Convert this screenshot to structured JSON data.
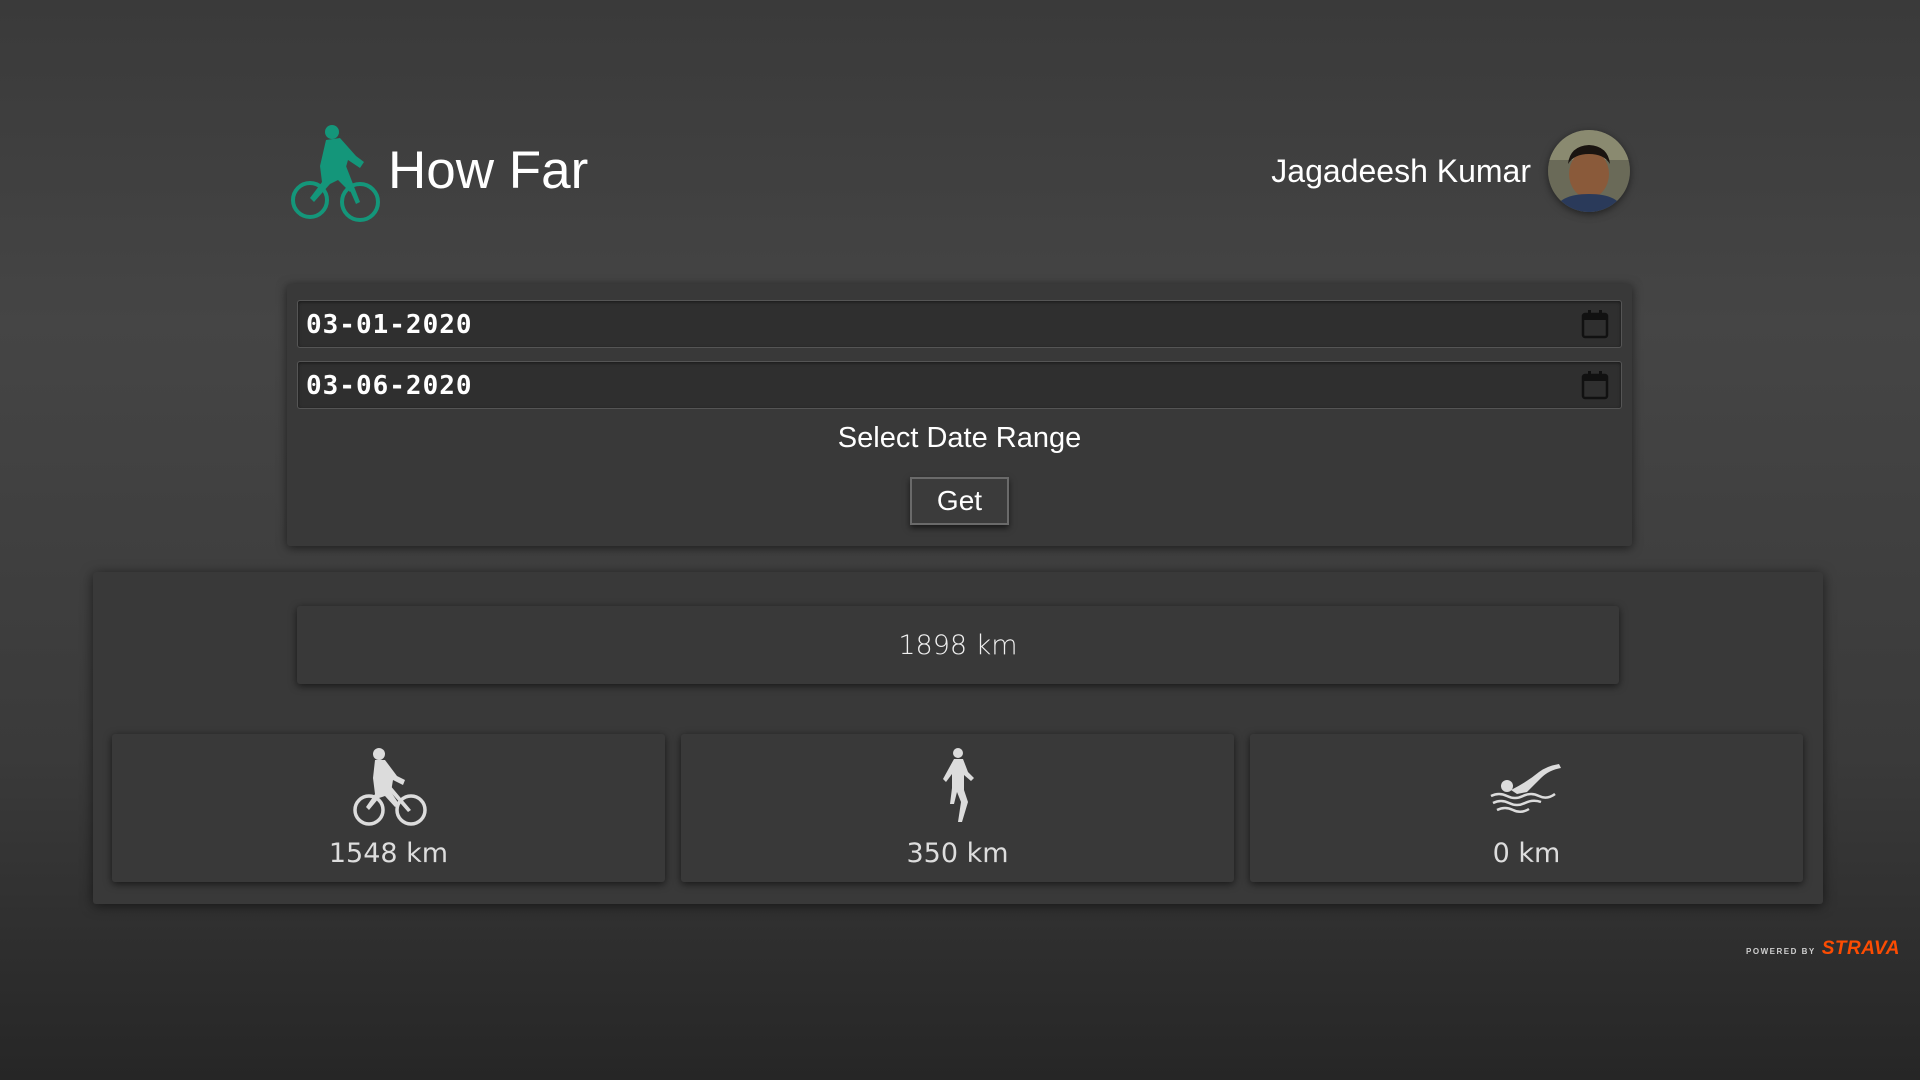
{
  "header": {
    "app_title": "How Far",
    "user_name": "Jagadeesh Kumar",
    "logo_icon": "cyclist-icon",
    "logo_color": "#14967a"
  },
  "date_range": {
    "start_date": "03-01-2020",
    "end_date": "03-06-2020",
    "label": "Select Date Range",
    "button_label": "Get"
  },
  "results": {
    "total": "1898 km",
    "sports": [
      {
        "icon": "cycling-icon",
        "value": "1548 km"
      },
      {
        "icon": "running-icon",
        "value": "350 km"
      },
      {
        "icon": "swimming-icon",
        "value": "0 km"
      }
    ]
  },
  "footer": {
    "powered_by": "POWERED BY",
    "brand": "STRAVA",
    "brand_color": "#fc4c02"
  }
}
